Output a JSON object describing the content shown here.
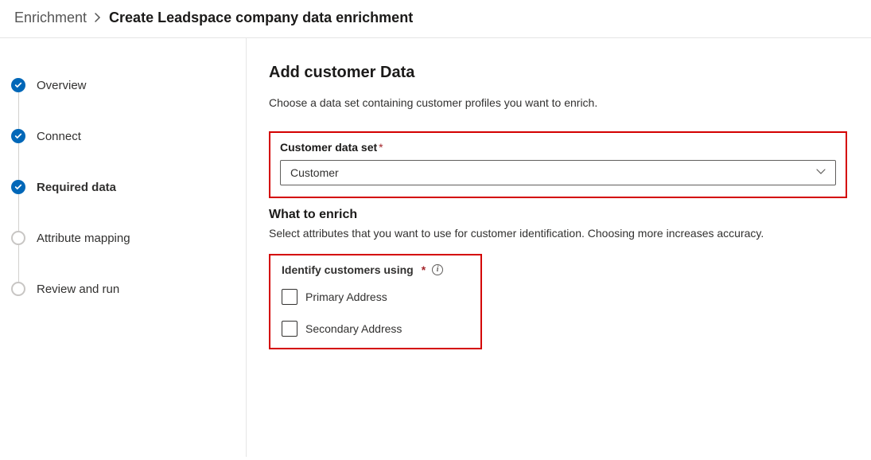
{
  "breadcrumb": {
    "parent": "Enrichment",
    "current": "Create Leadspace company data enrichment"
  },
  "steps": [
    {
      "label": "Overview",
      "state": "completed"
    },
    {
      "label": "Connect",
      "state": "completed"
    },
    {
      "label": "Required data",
      "state": "current"
    },
    {
      "label": "Attribute mapping",
      "state": "future"
    },
    {
      "label": "Review and run",
      "state": "future"
    }
  ],
  "main": {
    "title": "Add customer Data",
    "description": "Choose a data set containing customer profiles you want to enrich.",
    "dataset_label": "Customer data set",
    "dataset_value": "Customer",
    "enrich_title": "What to enrich",
    "enrich_description": "Select attributes that you want to use for customer identification. Choosing more increases accuracy.",
    "identify_label": "Identify customers using",
    "checkboxes": [
      {
        "label": "Primary Address",
        "checked": false
      },
      {
        "label": "Secondary Address",
        "checked": false
      }
    ]
  }
}
